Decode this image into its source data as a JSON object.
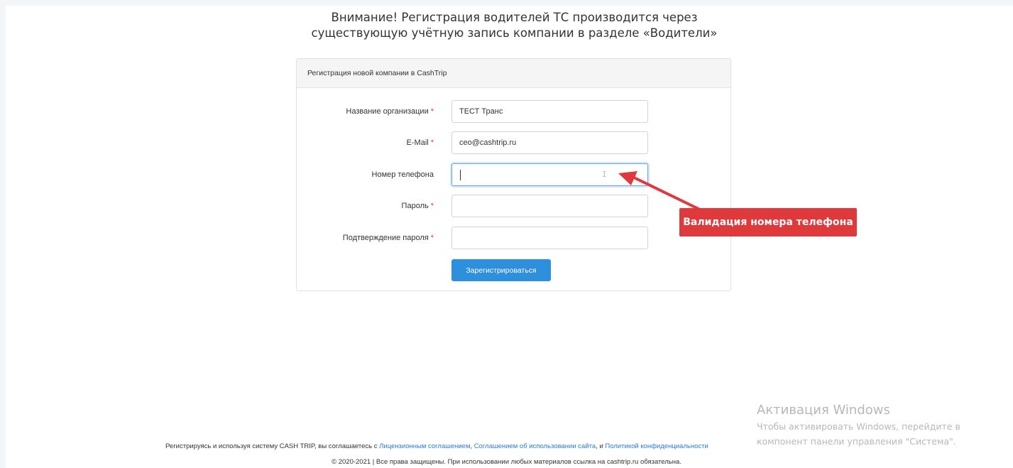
{
  "notice": {
    "line1": "Внимание! Регистрация водителей ТС производится через",
    "line2": "существующую учётную запись компании в разделе «Водители»"
  },
  "form": {
    "heading": "Регистрация новой компании в CashTrip",
    "fields": [
      {
        "label": "Название организации",
        "required": true,
        "value": "ТЕСТ Транс"
      },
      {
        "label": "E-Mail",
        "required": true,
        "value": "ceo@cashtrip.ru"
      },
      {
        "label": "Номер телефона",
        "required": false,
        "value": ""
      },
      {
        "label": "Пароль",
        "required": true,
        "value": ""
      },
      {
        "label": "Подтверждение пароля",
        "required": true,
        "value": ""
      }
    ],
    "required_mark": "*",
    "submit_label": "Зарегистрироваться"
  },
  "annotation": {
    "text": "Валидация номера телефона",
    "color": "#e0393b"
  },
  "watermark": {
    "title": "Активация Windows",
    "line1": "Чтобы активировать Windows, перейдите в",
    "line2": "компонент панели управления \"Система\"."
  },
  "footer": {
    "prefix": "Регистрируясь и используя систему CASH TRIP, вы соглашаетесь с ",
    "link1": "Лицензионным соглашением",
    "sep1": ", ",
    "link2": "Соглашением об использовании сайта",
    "sep2": ", и ",
    "link3": "Политикой конфиденциальности",
    "copyright": "© 2020-2021 | Все права защищены. При использовании любых материалов ссылка на cashtrip.ru обязательна."
  },
  "colors": {
    "accent": "#2e8fdc",
    "link": "#2e7bd6",
    "required": "#e53935"
  }
}
